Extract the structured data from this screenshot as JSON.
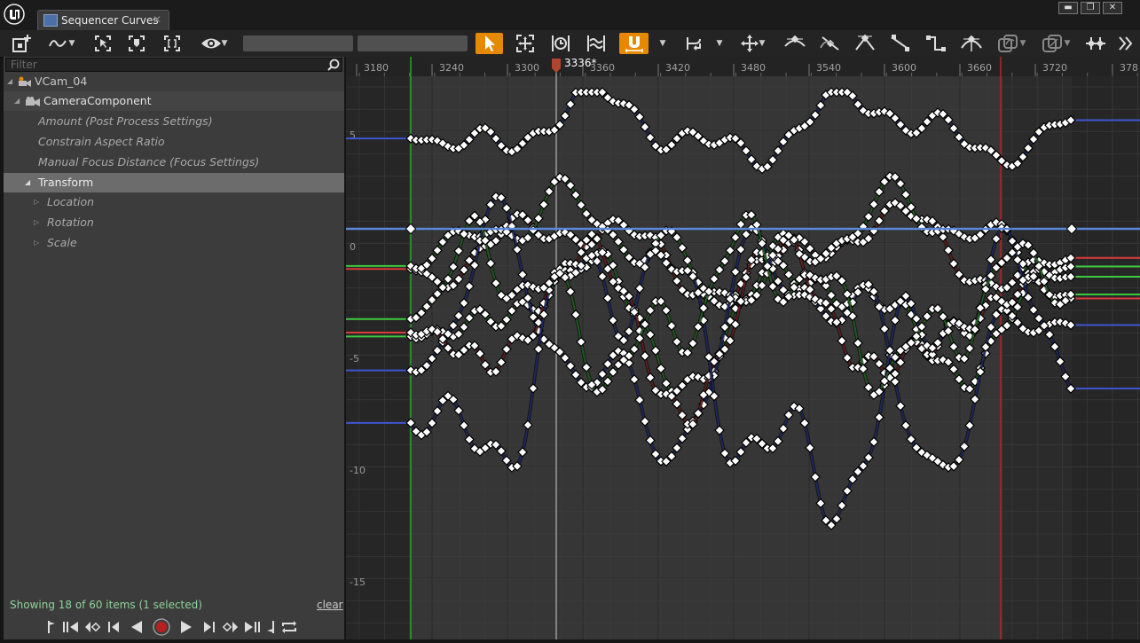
{
  "window": {
    "tab_title": "Sequencer Curves",
    "tab_close": "✕",
    "minimize": "▬",
    "maximize": "❐",
    "close": "✕"
  },
  "toolbar": {
    "icons": [
      "add-key-icon",
      "curve-interp-icon",
      "frame-selection-icon",
      "retime-icon",
      "fit-view-icon",
      "visibility-icon",
      "select-tool-icon",
      "transform-tool-icon",
      "retime-tool-icon",
      "multi-curve-icon",
      "snap-icon",
      "time-snap-icon",
      "move-tool-icon",
      "tangent-auto-icon",
      "tangent-user-icon",
      "tangent-break-icon",
      "tangent-linear-icon",
      "tangent-constant-icon",
      "tangent-flatten-icon",
      "curve-filter-icon",
      "curve-filter-2-icon",
      "curve-normalize-icon",
      "more-icon"
    ],
    "accent": "#e58a00"
  },
  "tree": {
    "filter_placeholder": "Filter",
    "items": [
      {
        "label": "VCam_04"
      },
      {
        "label": "CameraComponent"
      },
      {
        "label": "Amount (Post Process Settings)"
      },
      {
        "label": "Constrain Aspect Ratio"
      },
      {
        "label": "Manual Focus Distance (Focus Settings)"
      },
      {
        "label": "Transform"
      },
      {
        "label": "Location"
      },
      {
        "label": "Rotation"
      },
      {
        "label": "Scale"
      }
    ],
    "status": "Showing 18 of 60 items (1 selected)",
    "clear": "clear"
  },
  "transport": [
    "jump-start-icon",
    "prev-key-icon",
    "step-back-key-icon",
    "step-back-icon",
    "play-reverse-icon",
    "record-icon",
    "play-icon",
    "step-forward-icon",
    "next-key-icon",
    "jump-end-icon",
    "set-range-icon",
    "loop-icon"
  ],
  "timeline": {
    "current_frame": "3336*",
    "ticks": [
      "3180",
      "3240",
      "3300",
      "3360",
      "3420",
      "3480",
      "3540",
      "3600",
      "3660",
      "3720",
      "378"
    ]
  },
  "value_axis": {
    "labels": [
      "5",
      "0",
      "-5",
      "-10",
      "-15"
    ]
  },
  "colors": {
    "x_curve": "#d93b3b",
    "y_curve": "#3ec83e",
    "z_curve": "#3e55d0",
    "selected_curve": "#5a8ad6",
    "playhead": "#d8d8d8",
    "start_marker": "#26a826",
    "end_marker": "#a82a2a",
    "status_text": "#8fd39a"
  }
}
